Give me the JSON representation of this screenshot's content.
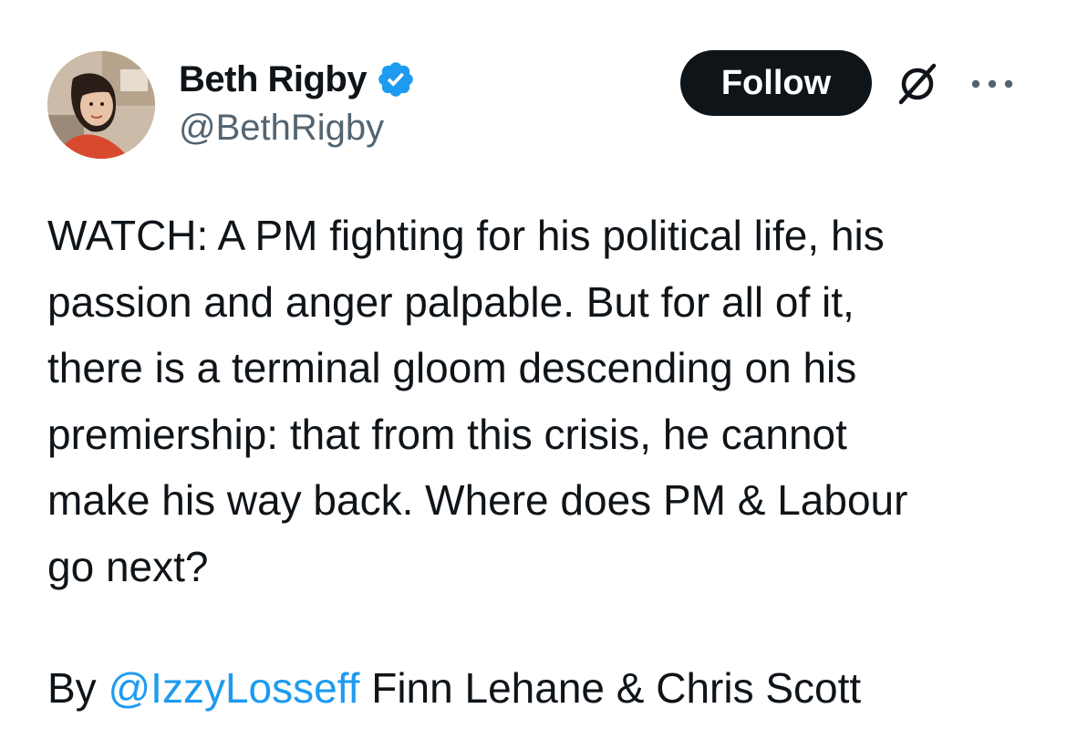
{
  "author": {
    "display_name": "Beth Rigby",
    "handle": "@BethRigby",
    "verified_icon": "verified-badge-icon",
    "verified_color": "#1d9bf0",
    "avatar_icon": "avatar-photo"
  },
  "actions": {
    "follow_label": "Follow",
    "grok_icon": "grok-icon",
    "more_icon": "more-options-icon"
  },
  "tweet": {
    "text": "WATCH: A PM fighting for his political life, his\npassion and anger palpable. But for all of it,\nthere is a terminal gloom descending on his\npremiership: that from this crisis, he cannot\nmake his way back. Where does PM & Labour\ngo next?",
    "byline_prefix": "By ",
    "byline_mention": "@IzzyLosseff",
    "byline_suffix": " Finn Lehane & Chris Scott"
  },
  "colors": {
    "text": "#0f1419",
    "secondary": "#536471",
    "link": "#1d9bf0",
    "button_bg": "#0f1419",
    "button_text": "#ffffff"
  }
}
